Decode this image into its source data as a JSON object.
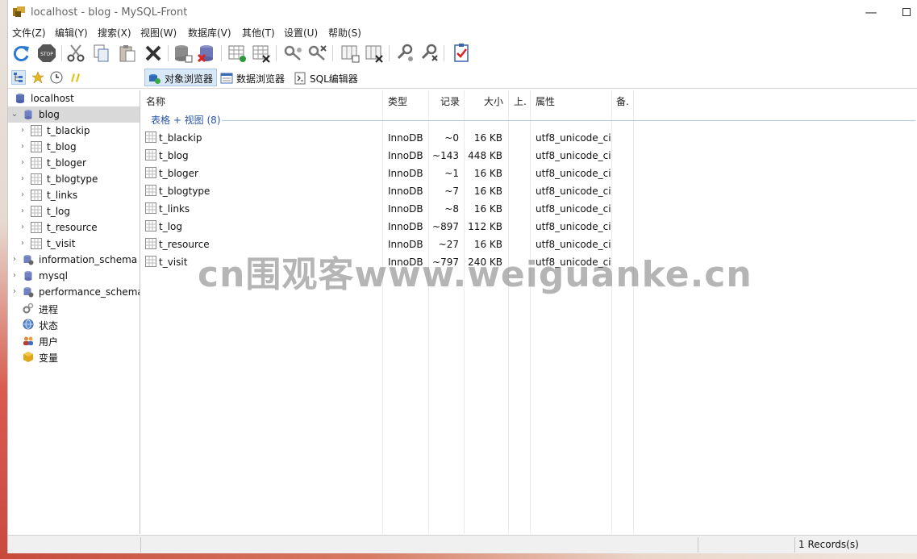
{
  "window": {
    "title": "localhost - blog - MySQL-Front"
  },
  "menu": [
    {
      "label": "文件(Z)"
    },
    {
      "label": "编辑(Y)"
    },
    {
      "label": "搜索(X)"
    },
    {
      "label": "视图(W)"
    },
    {
      "label": "数据库(V)"
    },
    {
      "label": "其他(T)"
    },
    {
      "label": "设置(U)"
    },
    {
      "label": "帮助(S)"
    }
  ],
  "view_tabs": [
    {
      "label": "对象浏览器",
      "active": true
    },
    {
      "label": "数据浏览器",
      "active": false
    },
    {
      "label": "SQL编辑器",
      "active": false
    }
  ],
  "tree": {
    "root": "localhost",
    "db_selected": "blog",
    "tables": [
      "t_blackip",
      "t_blog",
      "t_bloger",
      "t_blogtype",
      "t_links",
      "t_log",
      "t_resource",
      "t_visit"
    ],
    "other_dbs": [
      "information_schema",
      "mysql",
      "performance_schema"
    ],
    "extras": [
      "进程",
      "状态",
      "用户",
      "变量"
    ]
  },
  "list": {
    "columns": [
      "名称",
      "类型",
      "记录",
      "大小",
      "上.",
      "属性",
      "备."
    ],
    "group_label": "表格 + 视图 (8)",
    "rows": [
      {
        "name": "t_blackip",
        "type": "InnoDB",
        "records": "~0",
        "size": "16 KB",
        "attr": "utf8_unicode_ci"
      },
      {
        "name": "t_blog",
        "type": "InnoDB",
        "records": "~143",
        "size": "448 KB",
        "attr": "utf8_unicode_ci"
      },
      {
        "name": "t_bloger",
        "type": "InnoDB",
        "records": "~1",
        "size": "16 KB",
        "attr": "utf8_unicode_ci"
      },
      {
        "name": "t_blogtype",
        "type": "InnoDB",
        "records": "~7",
        "size": "16 KB",
        "attr": "utf8_unicode_ci"
      },
      {
        "name": "t_links",
        "type": "InnoDB",
        "records": "~8",
        "size": "16 KB",
        "attr": "utf8_unicode_ci"
      },
      {
        "name": "t_log",
        "type": "InnoDB",
        "records": "~897",
        "size": "112 KB",
        "attr": "utf8_unicode_ci"
      },
      {
        "name": "t_resource",
        "type": "InnoDB",
        "records": "~27",
        "size": "16 KB",
        "attr": "utf8_unicode_ci"
      },
      {
        "name": "t_visit",
        "type": "InnoDB",
        "records": "~797",
        "size": "240 KB",
        "attr": "utf8_unicode_ci"
      }
    ]
  },
  "watermark": "cn围观客www.weiguanke.cn",
  "status": {
    "records": "1 Records(s)"
  },
  "colors": {
    "accent": "#2a56a8",
    "selection": "#d9d9d9",
    "tab_active": "#d9e8f7"
  }
}
